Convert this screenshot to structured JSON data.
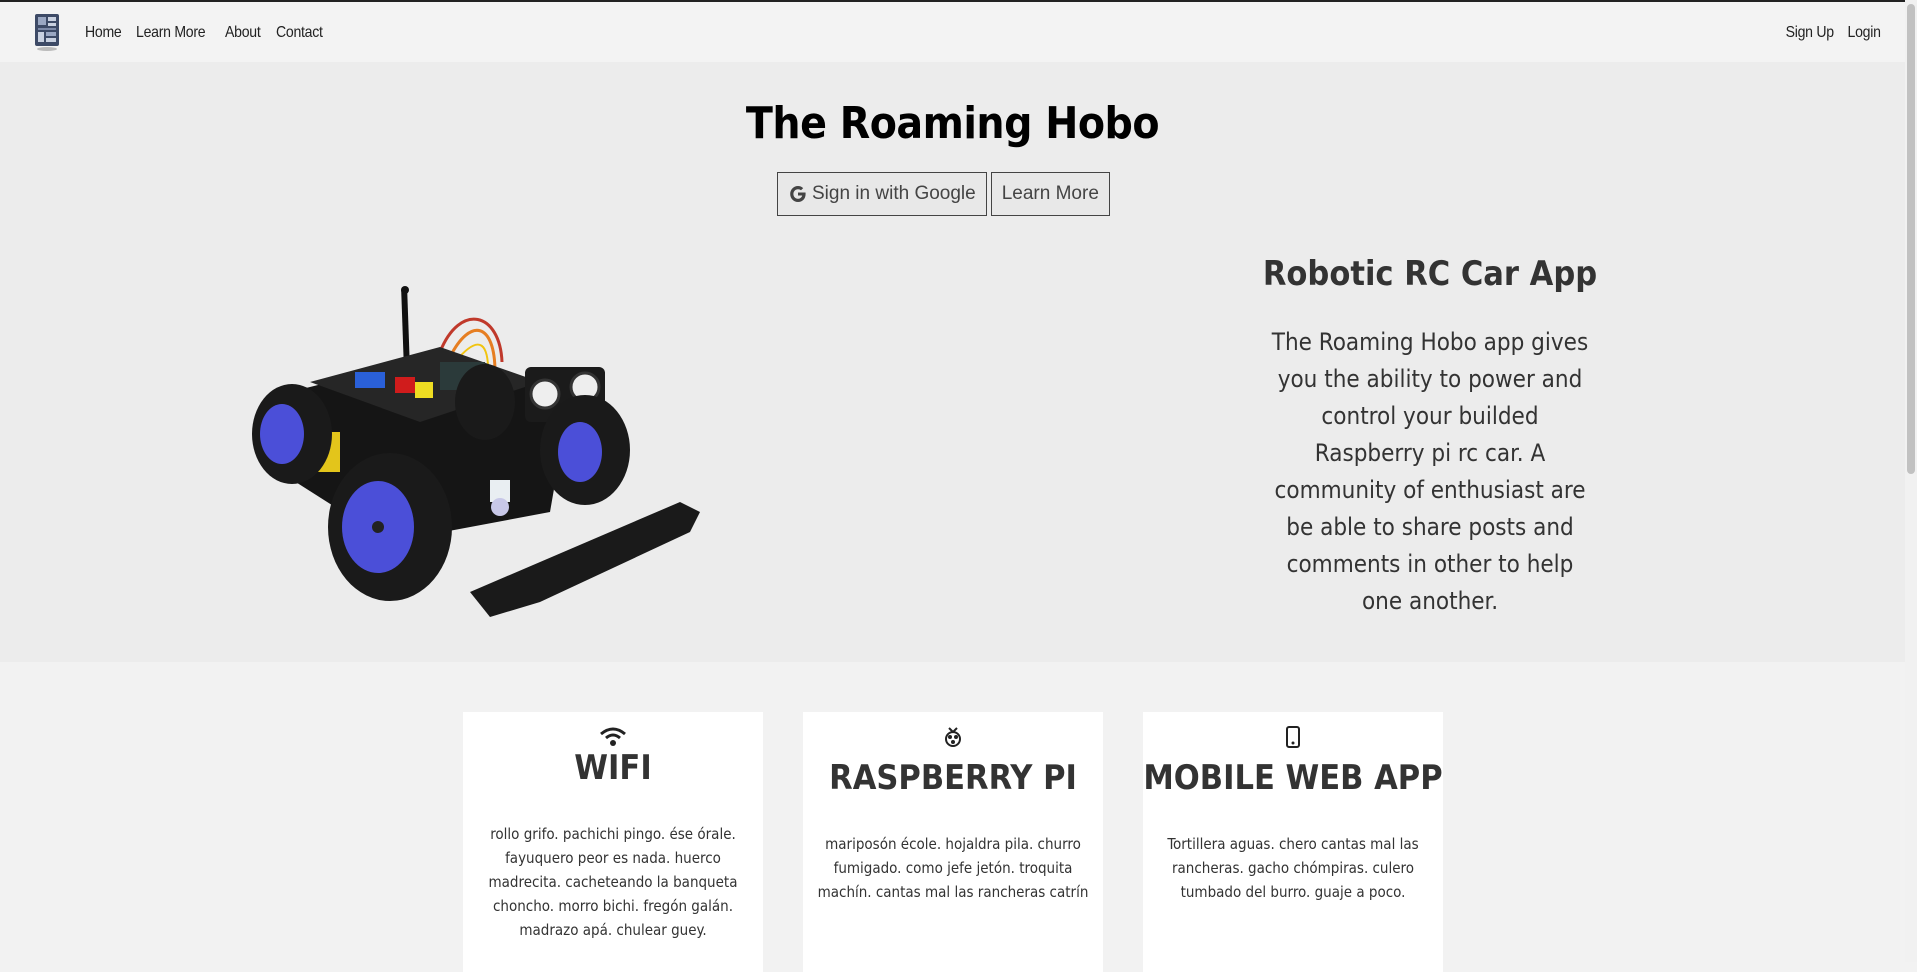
{
  "nav": {
    "logo_icon": "raspberry-board-logo",
    "left_links": [
      "Home",
      "Learn More",
      "About",
      "Contact"
    ],
    "right_links": [
      "Sign Up",
      "Login"
    ]
  },
  "hero": {
    "title": "The Roaming Hobo",
    "google_button": "Sign in with Google",
    "learn_more_button": "Learn More",
    "app_title": "Robotic RC Car App",
    "app_description": "The Roaming Hobo app gives you the ability to power and control your builded Raspberry pi rc car. A community of enthusiast are be able to share posts and comments in other to help one another."
  },
  "cards": [
    {
      "icon": "wifi-icon",
      "title": "WIFI",
      "text": "rollo grifo. pachichi pingo. ése órale. fayuquero peor es nada. huerco madrecita. cacheteando la banqueta choncho. morro bichi. fregón galán. madrazo apá. chulear guey."
    },
    {
      "icon": "raspberry-pi-icon",
      "title": "RASPBERRY PI",
      "text": "mariposón école. hojaldra pila. churro fumigado. como jefe jetón. troquita machín. cantas mal las rancheras catrín"
    },
    {
      "icon": "mobile-phone-icon",
      "title": "MOBILE WEB APP",
      "text": "Tortillera aguas. chero cantas mal las rancheras. gacho chómpiras. culero tumbado del burro. guaje a poco."
    }
  ],
  "colors": {
    "hero_bg": "#ececec",
    "page_bg": "#f2f2f2",
    "wheel_blue": "#4b4fd8"
  }
}
